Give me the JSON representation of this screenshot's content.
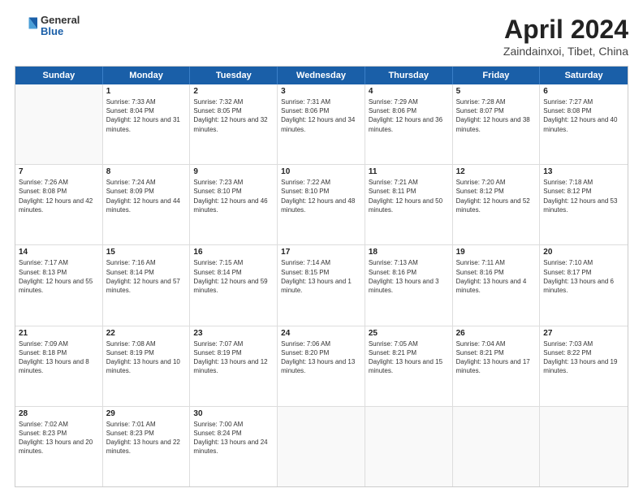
{
  "header": {
    "logo": {
      "general": "General",
      "blue": "Blue"
    },
    "title": "April 2024",
    "subtitle": "Zaindainxoi, Tibet, China"
  },
  "days": [
    "Sunday",
    "Monday",
    "Tuesday",
    "Wednesday",
    "Thursday",
    "Friday",
    "Saturday"
  ],
  "weeks": [
    [
      {
        "day": "",
        "empty": true
      },
      {
        "day": "1",
        "sunrise": "7:33 AM",
        "sunset": "8:04 PM",
        "daylight": "12 hours and 31 minutes."
      },
      {
        "day": "2",
        "sunrise": "7:32 AM",
        "sunset": "8:05 PM",
        "daylight": "12 hours and 32 minutes."
      },
      {
        "day": "3",
        "sunrise": "7:31 AM",
        "sunset": "8:06 PM",
        "daylight": "12 hours and 34 minutes."
      },
      {
        "day": "4",
        "sunrise": "7:29 AM",
        "sunset": "8:06 PM",
        "daylight": "12 hours and 36 minutes."
      },
      {
        "day": "5",
        "sunrise": "7:28 AM",
        "sunset": "8:07 PM",
        "daylight": "12 hours and 38 minutes."
      },
      {
        "day": "6",
        "sunrise": "7:27 AM",
        "sunset": "8:08 PM",
        "daylight": "12 hours and 40 minutes."
      }
    ],
    [
      {
        "day": "7",
        "sunrise": "7:26 AM",
        "sunset": "8:08 PM",
        "daylight": "12 hours and 42 minutes."
      },
      {
        "day": "8",
        "sunrise": "7:24 AM",
        "sunset": "8:09 PM",
        "daylight": "12 hours and 44 minutes."
      },
      {
        "day": "9",
        "sunrise": "7:23 AM",
        "sunset": "8:10 PM",
        "daylight": "12 hours and 46 minutes."
      },
      {
        "day": "10",
        "sunrise": "7:22 AM",
        "sunset": "8:10 PM",
        "daylight": "12 hours and 48 minutes."
      },
      {
        "day": "11",
        "sunrise": "7:21 AM",
        "sunset": "8:11 PM",
        "daylight": "12 hours and 50 minutes."
      },
      {
        "day": "12",
        "sunrise": "7:20 AM",
        "sunset": "8:12 PM",
        "daylight": "12 hours and 52 minutes."
      },
      {
        "day": "13",
        "sunrise": "7:18 AM",
        "sunset": "8:12 PM",
        "daylight": "12 hours and 53 minutes."
      }
    ],
    [
      {
        "day": "14",
        "sunrise": "7:17 AM",
        "sunset": "8:13 PM",
        "daylight": "12 hours and 55 minutes."
      },
      {
        "day": "15",
        "sunrise": "7:16 AM",
        "sunset": "8:14 PM",
        "daylight": "12 hours and 57 minutes."
      },
      {
        "day": "16",
        "sunrise": "7:15 AM",
        "sunset": "8:14 PM",
        "daylight": "12 hours and 59 minutes."
      },
      {
        "day": "17",
        "sunrise": "7:14 AM",
        "sunset": "8:15 PM",
        "daylight": "13 hours and 1 minute."
      },
      {
        "day": "18",
        "sunrise": "7:13 AM",
        "sunset": "8:16 PM",
        "daylight": "13 hours and 3 minutes."
      },
      {
        "day": "19",
        "sunrise": "7:11 AM",
        "sunset": "8:16 PM",
        "daylight": "13 hours and 4 minutes."
      },
      {
        "day": "20",
        "sunrise": "7:10 AM",
        "sunset": "8:17 PM",
        "daylight": "13 hours and 6 minutes."
      }
    ],
    [
      {
        "day": "21",
        "sunrise": "7:09 AM",
        "sunset": "8:18 PM",
        "daylight": "13 hours and 8 minutes."
      },
      {
        "day": "22",
        "sunrise": "7:08 AM",
        "sunset": "8:19 PM",
        "daylight": "13 hours and 10 minutes."
      },
      {
        "day": "23",
        "sunrise": "7:07 AM",
        "sunset": "8:19 PM",
        "daylight": "13 hours and 12 minutes."
      },
      {
        "day": "24",
        "sunrise": "7:06 AM",
        "sunset": "8:20 PM",
        "daylight": "13 hours and 13 minutes."
      },
      {
        "day": "25",
        "sunrise": "7:05 AM",
        "sunset": "8:21 PM",
        "daylight": "13 hours and 15 minutes."
      },
      {
        "day": "26",
        "sunrise": "7:04 AM",
        "sunset": "8:21 PM",
        "daylight": "13 hours and 17 minutes."
      },
      {
        "day": "27",
        "sunrise": "7:03 AM",
        "sunset": "8:22 PM",
        "daylight": "13 hours and 19 minutes."
      }
    ],
    [
      {
        "day": "28",
        "sunrise": "7:02 AM",
        "sunset": "8:23 PM",
        "daylight": "13 hours and 20 minutes."
      },
      {
        "day": "29",
        "sunrise": "7:01 AM",
        "sunset": "8:23 PM",
        "daylight": "13 hours and 22 minutes."
      },
      {
        "day": "30",
        "sunrise": "7:00 AM",
        "sunset": "8:24 PM",
        "daylight": "13 hours and 24 minutes."
      },
      {
        "day": "",
        "empty": true
      },
      {
        "day": "",
        "empty": true
      },
      {
        "day": "",
        "empty": true
      },
      {
        "day": "",
        "empty": true
      }
    ]
  ]
}
